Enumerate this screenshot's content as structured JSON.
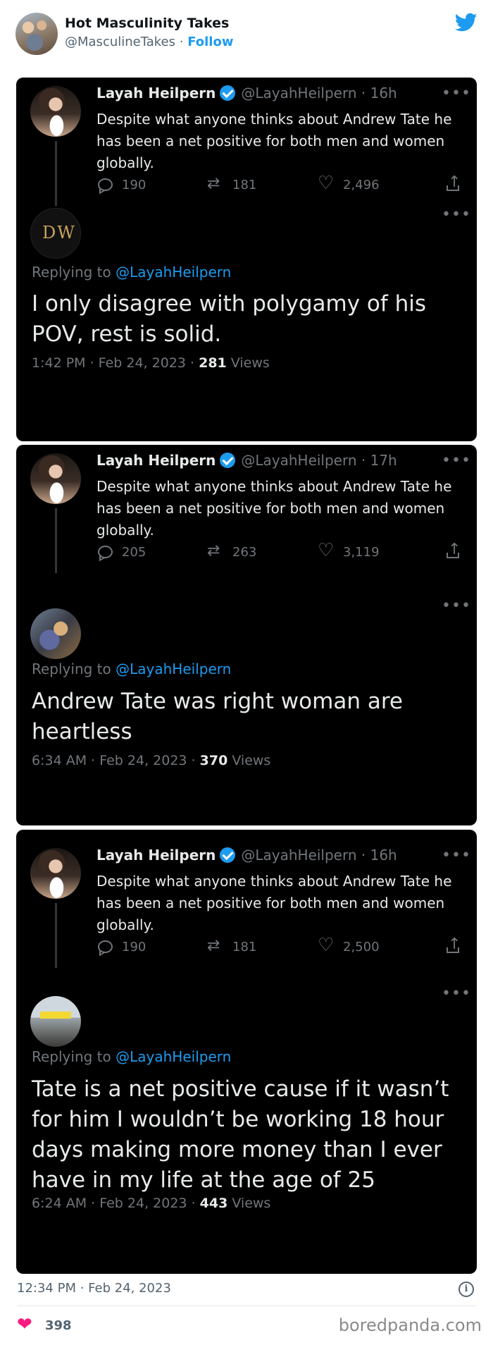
{
  "header": {
    "account_name": "Hot Masculinity Takes",
    "account_handle": "@MasculineTakes",
    "separator": " · ",
    "follow_label": "Follow",
    "icon": "twitter-bird-icon"
  },
  "panels": [
    {
      "quoted": {
        "name": "Layah Heilpern",
        "handle": "@LayahHeilpern · 16h",
        "text": "Despite what anyone thinks about Andrew Tate he has been a net positive for both men and women globally.",
        "replies": "190",
        "retweets": "181",
        "likes": "2,496"
      },
      "reply": {
        "avatar": "dw-logo-avatar",
        "avatar_text": "DW",
        "replying_prefix": "Replying to ",
        "replying_to": "@LayahHeilpern",
        "text": "I only disagree with polygamy of his POV, rest is solid.",
        "time": "1:42 PM · Feb 24, 2023 · ",
        "views_count": "281",
        "views_label": " Views"
      }
    },
    {
      "quoted": {
        "name": "Layah Heilpern",
        "handle": "@LayahHeilpern · 17h",
        "text": "Despite what anyone thinks about Andrew Tate he has been a net positive for both men and women globally.",
        "replies": "205",
        "retweets": "263",
        "likes": "3,119"
      },
      "reply": {
        "avatar": "photo-avatar",
        "replying_prefix": "Replying to ",
        "replying_to": "@LayahHeilpern",
        "text": "Andrew Tate was right woman are heartless",
        "time": "6:34 AM · Feb 24, 2023 · ",
        "views_count": "370",
        "views_label": " Views"
      }
    },
    {
      "quoted": {
        "name": "Layah Heilpern",
        "handle": "@LayahHeilpern · 16h",
        "text": "Despite what anyone thinks about Andrew Tate he has been a net positive for both men and women globally.",
        "replies": "190",
        "retweets": "181",
        "likes": "2,500"
      },
      "reply": {
        "avatar": "car-avatar",
        "replying_prefix": "Replying to ",
        "replying_to": "@LayahHeilpern",
        "text": "Tate is a net positive cause if it wasn’t for him I wouldn’t be working 18 hour days making more money than I ever have in my life at the age of 25",
        "time": "6:24 AM · Feb 24, 2023 · ",
        "views_count": "443",
        "views_label": " Views"
      }
    }
  ],
  "footer": {
    "time": "12:34 PM · Feb 24, 2023",
    "info_icon_glyph": "i",
    "likes_count": "398",
    "brand": "boredpanda.com"
  },
  "colors": {
    "accent": "#1d9bf0",
    "like": "#f91880",
    "panel_bg": "#000000",
    "muted": "#71767b"
  }
}
